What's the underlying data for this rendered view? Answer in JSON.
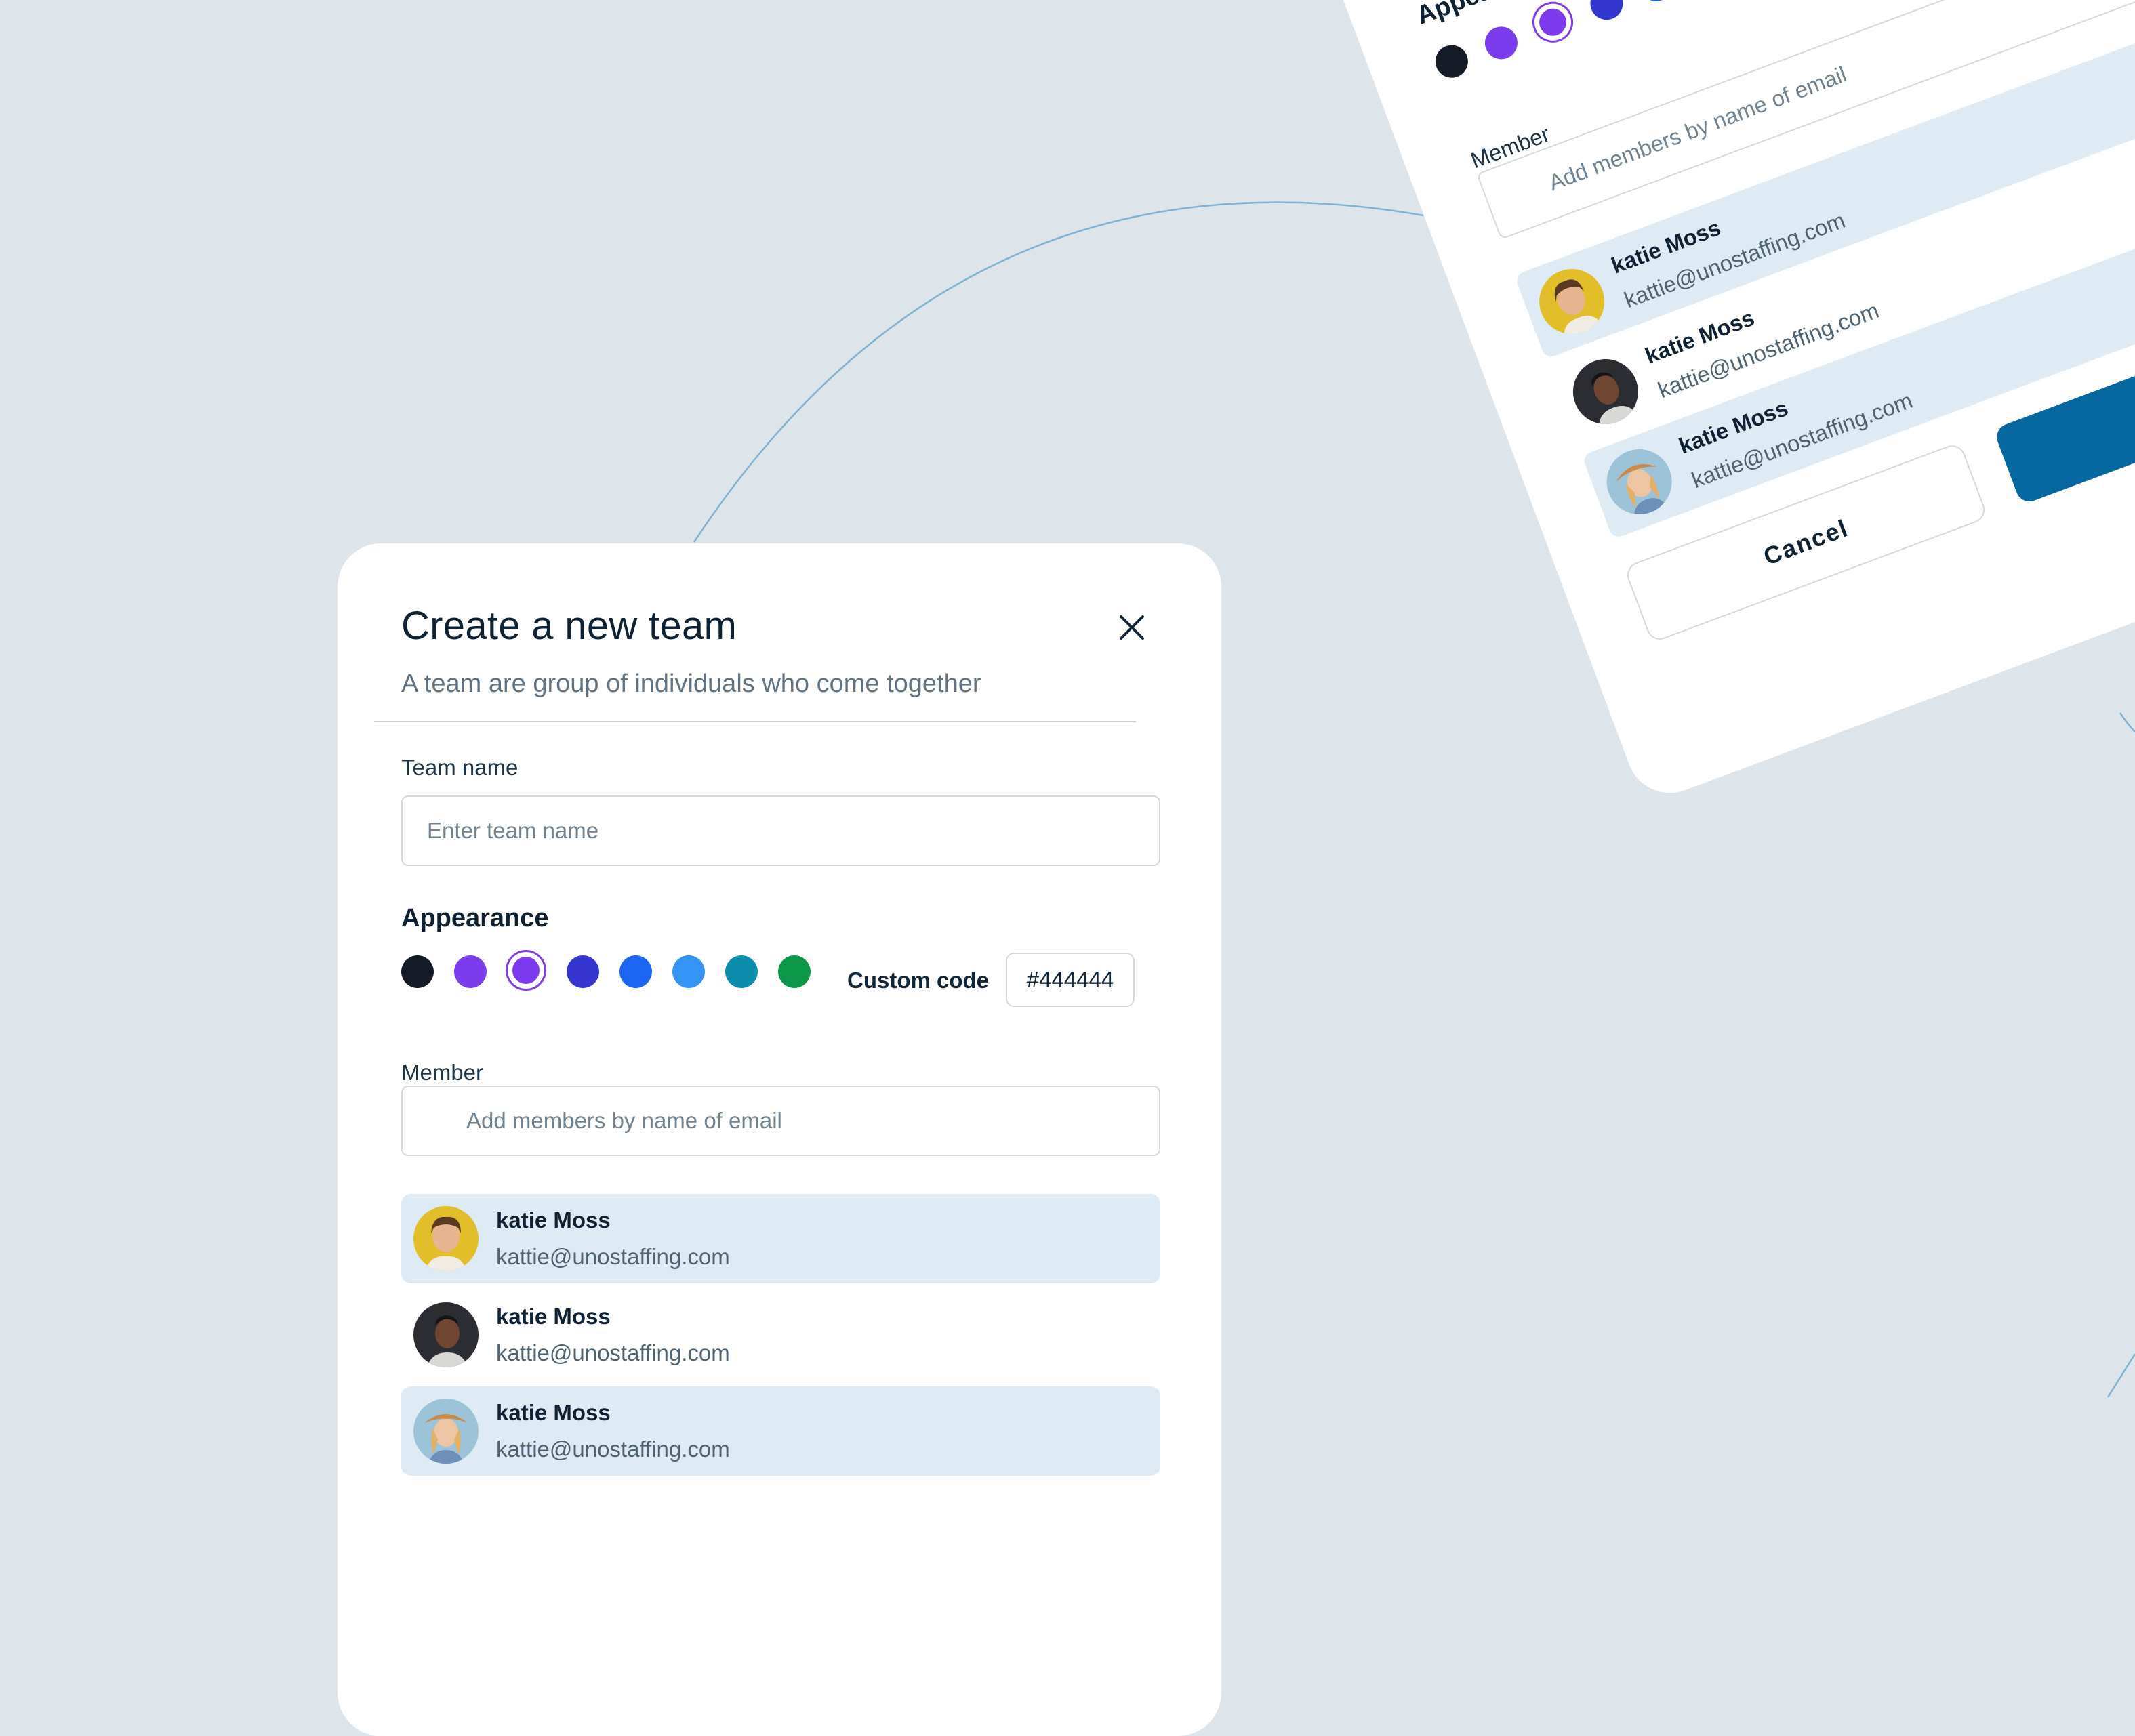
{
  "modal": {
    "title": "Create a new team",
    "subtitle": "A team are group of individuals who come together",
    "team_name_label": "Team name",
    "team_name_placeholder": "Enter team name",
    "appearance_label": "Appearance",
    "colors": [
      "#141b27",
      "#7a3cec",
      "#7e3bed",
      "#3437cf",
      "#1965f0",
      "#3393f5",
      "#0b8dad",
      "#0c9748"
    ],
    "selected_color_index": 2,
    "custom_code_label": "Custom code",
    "custom_code_value": "#444444",
    "member_label": "Member",
    "member_search_placeholder": "Add members by name of email",
    "members": [
      {
        "name": "katie Moss",
        "email": "kattie@unostaffing.com"
      },
      {
        "name": "katie Moss",
        "email": "kattie@unostaffing.com"
      },
      {
        "name": "katie Moss",
        "email": "kattie@unostaffing.com"
      }
    ],
    "cancel_label": "Cancel",
    "accent_color": "#04679f"
  }
}
